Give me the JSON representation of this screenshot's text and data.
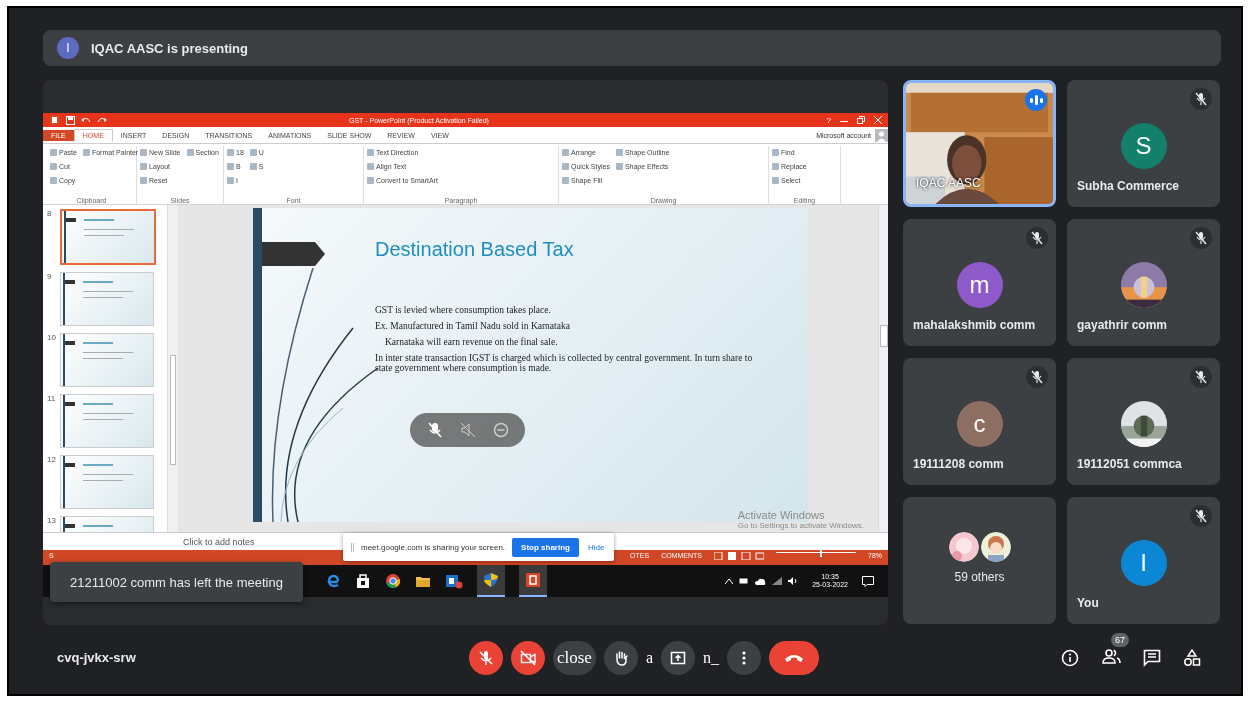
{
  "banner": {
    "avatar": "I",
    "text": "IQAC AASC is presenting"
  },
  "powerpoint": {
    "title": "GST - PowerPoint (Product Activation Failed)",
    "help": "?",
    "tabs": [
      {
        "label": "FILE",
        "kind": "file",
        "selected": false
      },
      {
        "label": "HOME",
        "kind": "tab",
        "selected": true
      },
      {
        "label": "INSERT",
        "kind": "tab",
        "selected": false
      },
      {
        "label": "DESIGN",
        "kind": "tab",
        "selected": false
      },
      {
        "label": "TRANSITIONS",
        "kind": "tab",
        "selected": false
      },
      {
        "label": "ANIMATIONS",
        "kind": "tab",
        "selected": false
      },
      {
        "label": "SLIDE SHOW",
        "kind": "tab",
        "selected": false
      },
      {
        "label": "REVIEW",
        "kind": "tab",
        "selected": false
      },
      {
        "label": "VIEW",
        "kind": "tab",
        "selected": false
      }
    ],
    "account": "Microsoft account",
    "ribbon_groups": [
      {
        "label": "Clipboard",
        "items": [
          "Paste",
          "Cut",
          "Copy",
          "Format Painter"
        ]
      },
      {
        "label": "Slides",
        "items": [
          "New Slide",
          "Layout",
          "Reset",
          "Section"
        ]
      },
      {
        "label": "Font",
        "items": [
          "18",
          "B",
          "I",
          "U",
          "S"
        ]
      },
      {
        "label": "Paragraph",
        "items": [
          "Text Direction",
          "Align Text",
          "Convert to SmartArt"
        ]
      },
      {
        "label": "Drawing",
        "items": [
          "Arrange",
          "Quick Styles",
          "Shape Fill",
          "Shape Outline",
          "Shape Effects"
        ]
      },
      {
        "label": "Editing",
        "items": [
          "Find",
          "Replace",
          "Select"
        ]
      }
    ],
    "thumbnails": [
      {
        "number": "8",
        "selected": true
      },
      {
        "number": "9",
        "selected": false
      },
      {
        "number": "10",
        "selected": false
      },
      {
        "number": "11",
        "selected": false
      },
      {
        "number": "12",
        "selected": false
      },
      {
        "number": "13",
        "selected": false
      }
    ],
    "slide": {
      "title": "Destination Based Tax",
      "lines": [
        {
          "text": "GST is levied where consumption takes place.",
          "kind": "plain"
        },
        {
          "text": "Ex. Manufactured in Tamil Nadu sold in Karnataka",
          "kind": "plain"
        },
        {
          "text": "Karnataka will earn revenue on the final sale.",
          "kind": "indented"
        },
        {
          "text": "In inter state transaction IGST is charged which is collected by central government. In turn share to state government where consumption is made.",
          "kind": "plain"
        }
      ]
    },
    "notes_placeholder": "Click to add notes",
    "activation": {
      "title": "Activate Windows",
      "text": "Go to Settings to activate Windows."
    },
    "status_bar": {
      "left": "S",
      "items": [
        "OTES",
        "COMMENTS"
      ],
      "zoom": "78%",
      "level": 0.55
    },
    "taskbar": {
      "time": "10:35",
      "date": "25-03-2022"
    }
  },
  "share_bar": {
    "text": "meet.google.com is sharing your screen.",
    "stop": "Stop sharing",
    "hide": "Hide"
  },
  "toast": "21211002 comm has left the meeting",
  "tiles": [
    {
      "name": "IQAC AASC",
      "kind": "video",
      "muted": false,
      "speaking": true
    },
    {
      "name": "Subha Commerce",
      "kind": "avatar",
      "letter": "S",
      "color": "#12806a",
      "muted": true,
      "speaking": false
    },
    {
      "name": "mahalakshmib comm",
      "kind": "avatar",
      "letter": "m",
      "color": "#8e59c9",
      "muted": true,
      "speaking": false
    },
    {
      "name": "gayathrir comm",
      "muted": true,
      "speaking": false
    },
    {
      "name": "19111208 comm",
      "kind": "avatar",
      "letter": "c",
      "color": "#8d6e63",
      "muted": true,
      "speaking": false
    },
    {
      "name": "19112051 commca",
      "muted": true,
      "speaking": false
    },
    {
      "name": "59 others",
      "kind": "others",
      "muted": false,
      "speaking": false
    },
    {
      "name": "You",
      "kind": "avatar",
      "letter": "I",
      "color": "#0b87d6",
      "muted": true,
      "speaking": false
    }
  ],
  "bottom": {
    "meeting_code": "cvq-jvkx-srw",
    "controls": [
      {
        "kind": "mic",
        "on": false
      },
      {
        "kind": "camera",
        "on": false
      },
      {
        "kind": "captions",
        "label": "close"
      },
      {
        "kind": "hand"
      },
      {
        "kind": "glyph",
        "label": "a"
      },
      {
        "kind": "present"
      },
      {
        "kind": "glyph",
        "label": "n_"
      },
      {
        "kind": "more"
      },
      {
        "kind": "end"
      }
    ],
    "people_count": "67"
  }
}
